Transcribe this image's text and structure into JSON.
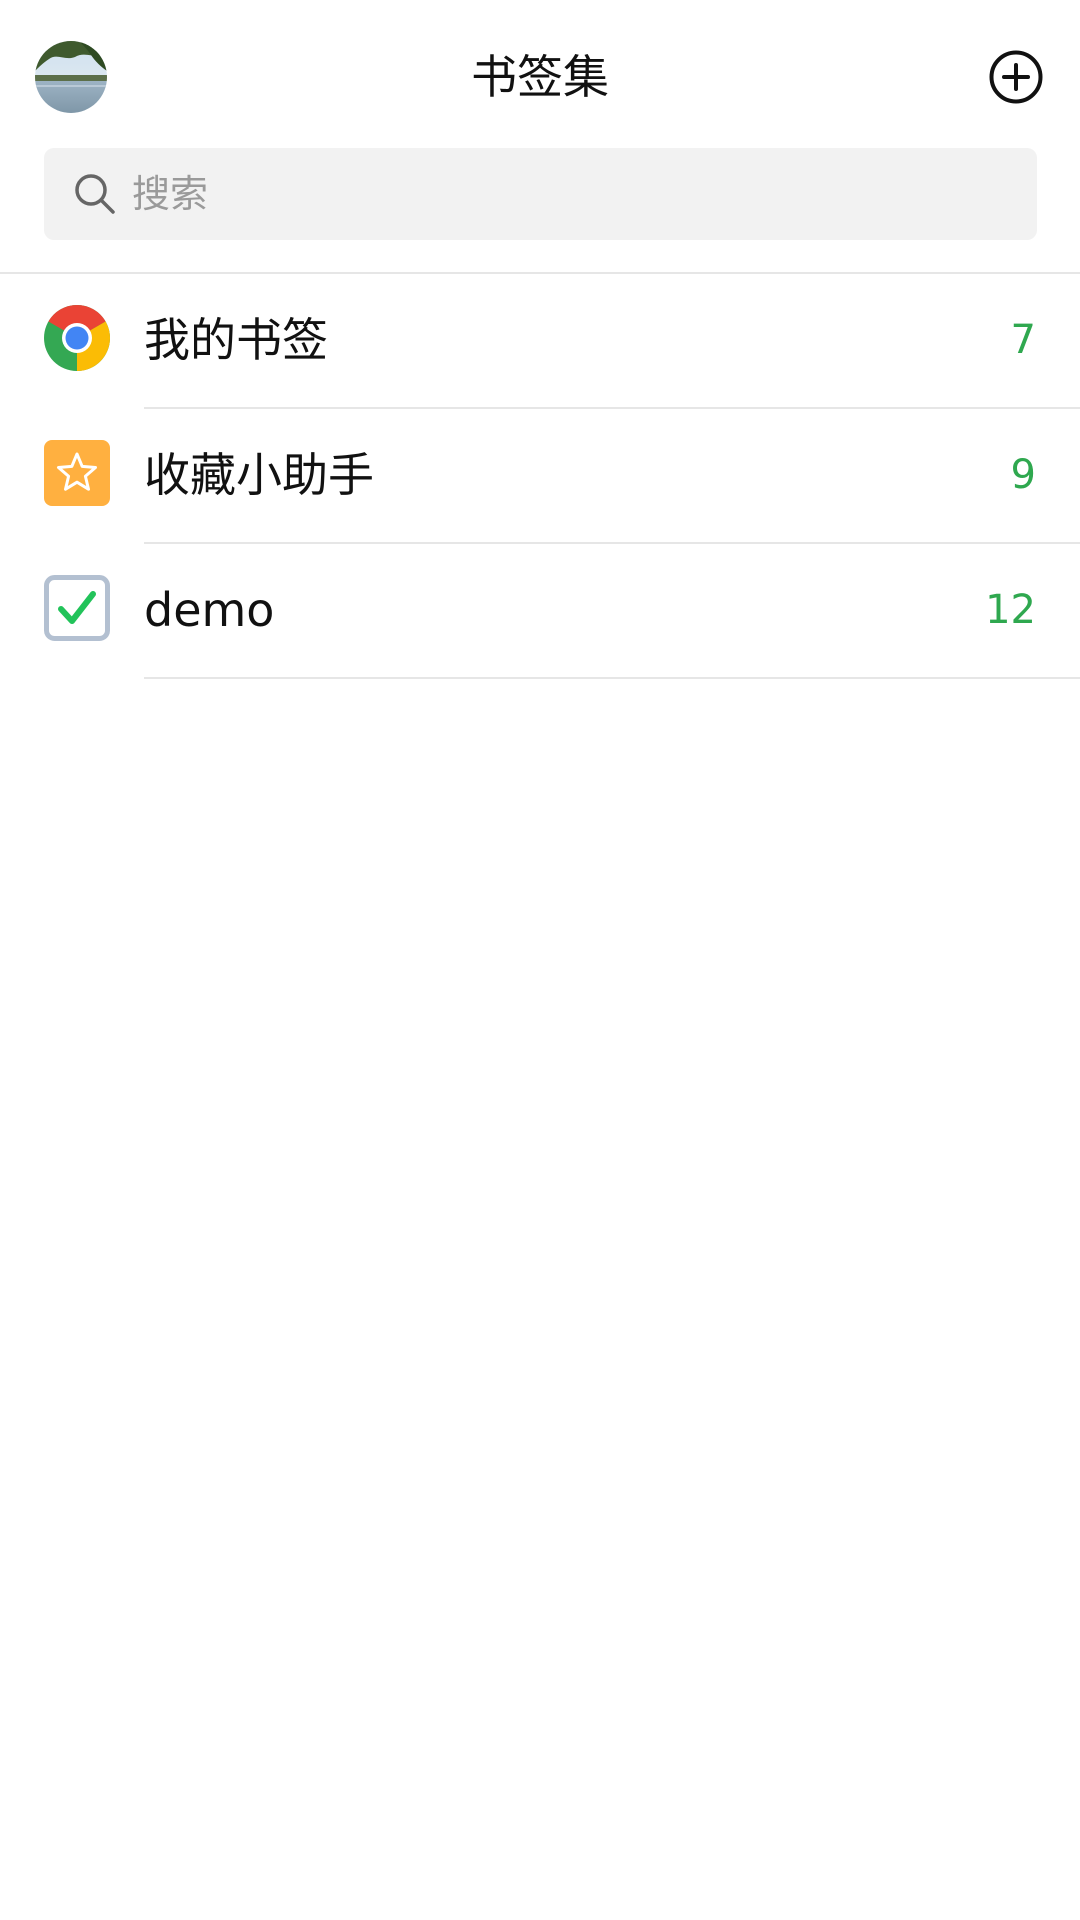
{
  "header": {
    "title": "书签集",
    "avatar_icon": "landscape-photo-avatar",
    "add_icon": "plus-circle-icon"
  },
  "search": {
    "placeholder": "搜索",
    "icon": "search-icon"
  },
  "list": {
    "items": [
      {
        "label": "我的书签",
        "count": "7",
        "icon": "chrome-icon"
      },
      {
        "label": "收藏小助手",
        "count": "9",
        "icon": "star-icon"
      },
      {
        "label": "demo",
        "count": "12",
        "icon": "checkbox-checked-icon"
      }
    ]
  },
  "colors": {
    "count_green": "#2fa84f",
    "star_orange": "#ffb040",
    "divider": "#e6e6e6",
    "search_bg": "#f2f2f2"
  }
}
